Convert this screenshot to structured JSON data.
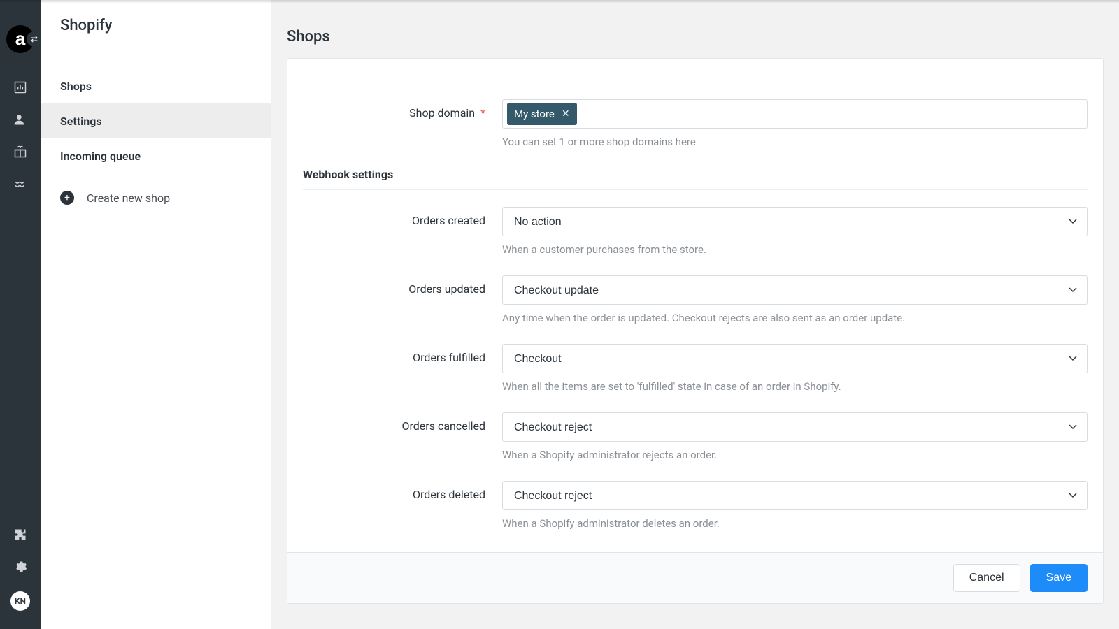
{
  "rail": {
    "avatar_initials": "KN"
  },
  "sidebar": {
    "title": "Shopify",
    "items": [
      {
        "label": "Shops"
      },
      {
        "label": "Settings"
      },
      {
        "label": "Incoming queue"
      }
    ],
    "create_label": "Create new shop"
  },
  "page": {
    "title": "Shops"
  },
  "form": {
    "shop_domain": {
      "label": "Shop domain",
      "required_mark": "*",
      "tags": [
        "My store"
      ],
      "helper": "You can set 1 or more shop domains here"
    },
    "webhook_section_title": "Webhook settings",
    "webhooks": [
      {
        "key": "orders_created",
        "label": "Orders created",
        "value": "No action",
        "helper": "When a customer purchases from the store."
      },
      {
        "key": "orders_updated",
        "label": "Orders updated",
        "value": "Checkout update",
        "helper": "Any time when the order is updated. Checkout rejects are also sent as an order update."
      },
      {
        "key": "orders_fulfilled",
        "label": "Orders fulfilled",
        "value": "Checkout",
        "helper": "When all the items are set to 'fulfilled' state in case of an order in Shopify."
      },
      {
        "key": "orders_cancelled",
        "label": "Orders cancelled",
        "value": "Checkout reject",
        "helper": "When a Shopify administrator rejects an order."
      },
      {
        "key": "orders_deleted",
        "label": "Orders deleted",
        "value": "Checkout reject",
        "helper": "When a Shopify administrator deletes an order."
      }
    ]
  },
  "footer": {
    "cancel": "Cancel",
    "save": "Save"
  }
}
